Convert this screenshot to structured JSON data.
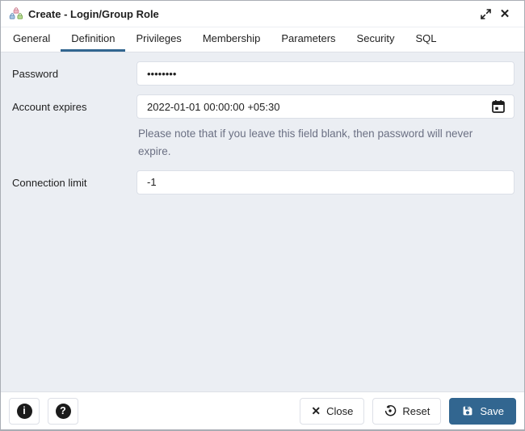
{
  "window": {
    "title": "Create - Login/Group Role"
  },
  "tabs": [
    {
      "label": "General"
    },
    {
      "label": "Definition",
      "active": true
    },
    {
      "label": "Privileges"
    },
    {
      "label": "Membership"
    },
    {
      "label": "Parameters"
    },
    {
      "label": "Security"
    },
    {
      "label": "SQL"
    }
  ],
  "form": {
    "password": {
      "label": "Password",
      "value": "••••••••"
    },
    "account_expires": {
      "label": "Account expires",
      "value": "2022-01-01 00:00:00 +05:30",
      "helper": "Please note that if you leave this field blank, then password will never expire."
    },
    "connection_limit": {
      "label": "Connection limit",
      "value": "-1"
    }
  },
  "footer": {
    "close_label": "Close",
    "reset_label": "Reset",
    "save_label": "Save"
  },
  "icons": {
    "info": "i",
    "help": "?",
    "close_x": "✕"
  },
  "colors": {
    "accent": "#326690",
    "content_bg": "#ebeef3",
    "helper_text": "#6b7083",
    "icon_black": "#1b1b1b"
  }
}
